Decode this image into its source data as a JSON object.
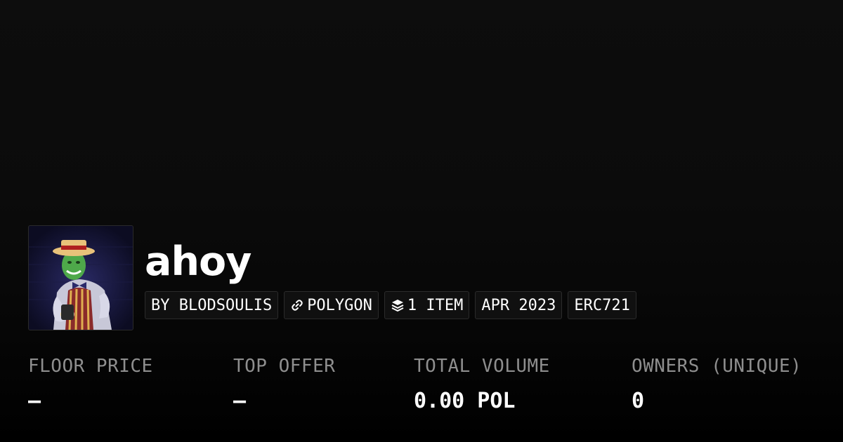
{
  "collection": {
    "name": "ahoy",
    "avatar_icon": "collection-avatar-image"
  },
  "tags": {
    "creator": "BY BLODSOULIS",
    "chain": "POLYGON",
    "chain_icon": "chain-link-icon",
    "items": "1 ITEM",
    "items_icon": "layers-icon",
    "date": "APR 2023",
    "standard": "ERC721"
  },
  "stats": {
    "floor_price": {
      "label": "FLOOR PRICE",
      "value": "–"
    },
    "top_offer": {
      "label": "TOP OFFER",
      "value": "–"
    },
    "total_volume": {
      "label": "TOTAL VOLUME",
      "value": "0.00 POL"
    },
    "owners": {
      "label": "OWNERS (UNIQUE)",
      "value": "0"
    }
  },
  "colors": {
    "background": "#000000",
    "label": "#8e8e8e",
    "text": "#ffffff",
    "tag_border": "#2b2b2b"
  }
}
